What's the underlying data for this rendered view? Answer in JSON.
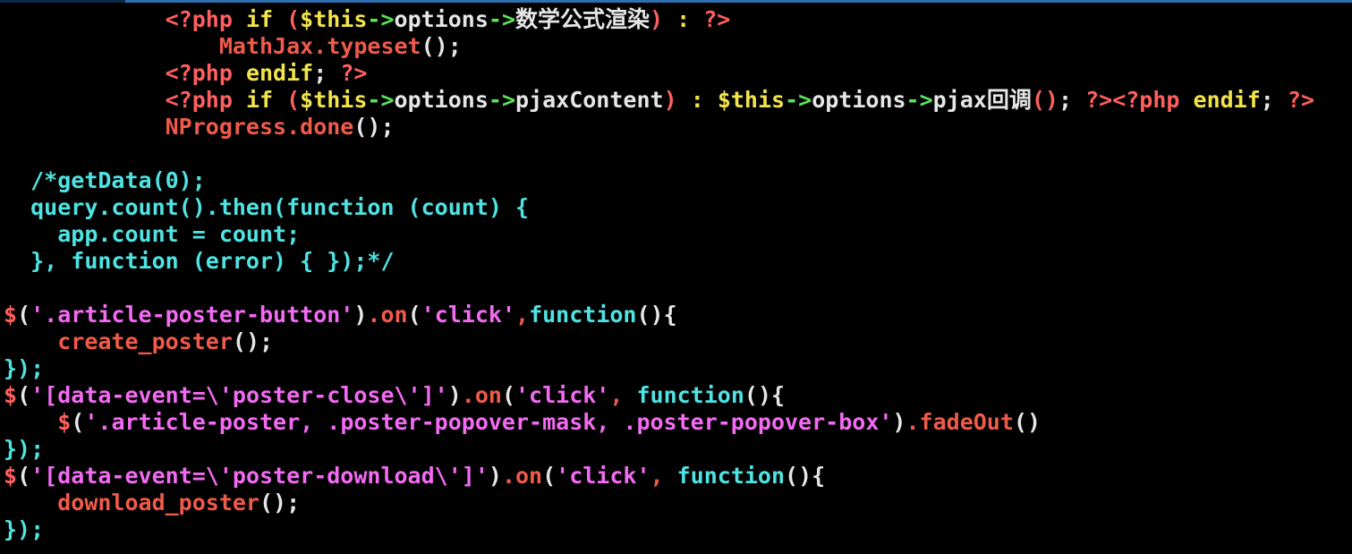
{
  "colors": {
    "background": "#000000",
    "red": "#ff5f5f",
    "salmon": "#f05a4a",
    "yellow": "#f2e44a",
    "green": "#59e35a",
    "cyan": "#4fe3e3",
    "magenta": "#f36af3",
    "white": "#e6e6e6"
  },
  "code_lines": [
    {
      "indent": "      ",
      "tokens": [
        {
          "t": "<?php ",
          "c": "red"
        },
        {
          "t": "if",
          "c": "yellow"
        },
        {
          "t": " (",
          "c": "red"
        },
        {
          "t": "$this",
          "c": "yellow"
        },
        {
          "t": "->",
          "c": "green"
        },
        {
          "t": "options",
          "c": "white"
        },
        {
          "t": "->",
          "c": "green"
        },
        {
          "t": "数学公式渲染",
          "c": "white"
        },
        {
          "t": ") ",
          "c": "red"
        },
        {
          "t": ":",
          "c": "yellow"
        },
        {
          "t": " ?>",
          "c": "red"
        }
      ]
    },
    {
      "indent": "        ",
      "tokens": [
        {
          "t": "MathJax.typeset",
          "c": "salmon"
        },
        {
          "t": "();",
          "c": "white"
        }
      ]
    },
    {
      "indent": "      ",
      "tokens": [
        {
          "t": "<?php ",
          "c": "red"
        },
        {
          "t": "endif",
          "c": "yellow"
        },
        {
          "t": ";",
          "c": "white"
        },
        {
          "t": " ?>",
          "c": "red"
        }
      ]
    },
    {
      "indent": "      ",
      "tokens": [
        {
          "t": "<?php ",
          "c": "red"
        },
        {
          "t": "if",
          "c": "yellow"
        },
        {
          "t": " (",
          "c": "red"
        },
        {
          "t": "$this",
          "c": "yellow"
        },
        {
          "t": "->",
          "c": "green"
        },
        {
          "t": "options",
          "c": "white"
        },
        {
          "t": "->",
          "c": "green"
        },
        {
          "t": "pjaxContent",
          "c": "white"
        },
        {
          "t": ") ",
          "c": "red"
        },
        {
          "t": ":",
          "c": "yellow"
        },
        {
          "t": " ",
          "c": "white"
        },
        {
          "t": "$this",
          "c": "yellow"
        },
        {
          "t": "->",
          "c": "green"
        },
        {
          "t": "options",
          "c": "white"
        },
        {
          "t": "->",
          "c": "green"
        },
        {
          "t": "pjax回调",
          "c": "white"
        },
        {
          "t": "()",
          "c": "red"
        },
        {
          "t": ";",
          "c": "white"
        },
        {
          "t": " ?><?php ",
          "c": "red"
        },
        {
          "t": "endif",
          "c": "yellow"
        },
        {
          "t": ";",
          "c": "white"
        },
        {
          "t": " ?>",
          "c": "red"
        }
      ]
    },
    {
      "indent": "      ",
      "tokens": [
        {
          "t": "NProgress.done",
          "c": "salmon"
        },
        {
          "t": "();",
          "c": "white"
        }
      ]
    },
    {
      "indent": "",
      "tokens": []
    },
    {
      "indent": " ",
      "tokens": [
        {
          "t": "/*getData(0);",
          "c": "cyan"
        }
      ]
    },
    {
      "indent": " ",
      "tokens": [
        {
          "t": "query.count().then(function (count) {",
          "c": "cyan"
        }
      ]
    },
    {
      "indent": "  ",
      "tokens": [
        {
          "t": "app.count = count;",
          "c": "cyan"
        }
      ]
    },
    {
      "indent": " ",
      "tokens": [
        {
          "t": "}, function (error) { });*/",
          "c": "cyan"
        }
      ]
    },
    {
      "indent": "",
      "tokens": []
    },
    {
      "indent": "",
      "tokens": [
        {
          "t": "$",
          "c": "red"
        },
        {
          "t": "(",
          "c": "white"
        },
        {
          "t": "'.article-poster-button'",
          "c": "magenta"
        },
        {
          "t": ")",
          "c": "white"
        },
        {
          "t": ".on",
          "c": "salmon"
        },
        {
          "t": "(",
          "c": "white"
        },
        {
          "t": "'click'",
          "c": "magenta"
        },
        {
          "t": ",",
          "c": "salmon"
        },
        {
          "t": "function",
          "c": "cyan"
        },
        {
          "t": "(){",
          "c": "white"
        }
      ]
    },
    {
      "indent": "  ",
      "tokens": [
        {
          "t": "create_poster",
          "c": "salmon"
        },
        {
          "t": "();",
          "c": "white"
        }
      ]
    },
    {
      "indent": "",
      "tokens": [
        {
          "t": "});",
          "c": "cyan"
        }
      ]
    },
    {
      "indent": "",
      "tokens": [
        {
          "t": "$",
          "c": "red"
        },
        {
          "t": "(",
          "c": "white"
        },
        {
          "t": "'[data-event=\\'poster-close\\']'",
          "c": "magenta"
        },
        {
          "t": ")",
          "c": "white"
        },
        {
          "t": ".on",
          "c": "salmon"
        },
        {
          "t": "(",
          "c": "white"
        },
        {
          "t": "'click'",
          "c": "magenta"
        },
        {
          "t": ", ",
          "c": "salmon"
        },
        {
          "t": "function",
          "c": "cyan"
        },
        {
          "t": "(){",
          "c": "white"
        }
      ]
    },
    {
      "indent": "  ",
      "tokens": [
        {
          "t": "$",
          "c": "red"
        },
        {
          "t": "(",
          "c": "white"
        },
        {
          "t": "'.article-poster, .poster-popover-mask, .poster-popover-box'",
          "c": "magenta"
        },
        {
          "t": ")",
          "c": "white"
        },
        {
          "t": ".fadeOut",
          "c": "salmon"
        },
        {
          "t": "()",
          "c": "white"
        }
      ]
    },
    {
      "indent": "",
      "tokens": [
        {
          "t": "});",
          "c": "cyan"
        }
      ]
    },
    {
      "indent": "",
      "tokens": [
        {
          "t": "$",
          "c": "red"
        },
        {
          "t": "(",
          "c": "white"
        },
        {
          "t": "'[data-event=\\'poster-download\\']'",
          "c": "magenta"
        },
        {
          "t": ")",
          "c": "white"
        },
        {
          "t": ".on",
          "c": "salmon"
        },
        {
          "t": "(",
          "c": "white"
        },
        {
          "t": "'click'",
          "c": "magenta"
        },
        {
          "t": ", ",
          "c": "salmon"
        },
        {
          "t": "function",
          "c": "cyan"
        },
        {
          "t": "(){",
          "c": "white"
        }
      ]
    },
    {
      "indent": "  ",
      "tokens": [
        {
          "t": "download_poster",
          "c": "salmon"
        },
        {
          "t": "();",
          "c": "white"
        }
      ]
    },
    {
      "indent": "",
      "tokens": [
        {
          "t": "});",
          "c": "cyan"
        }
      ]
    }
  ]
}
